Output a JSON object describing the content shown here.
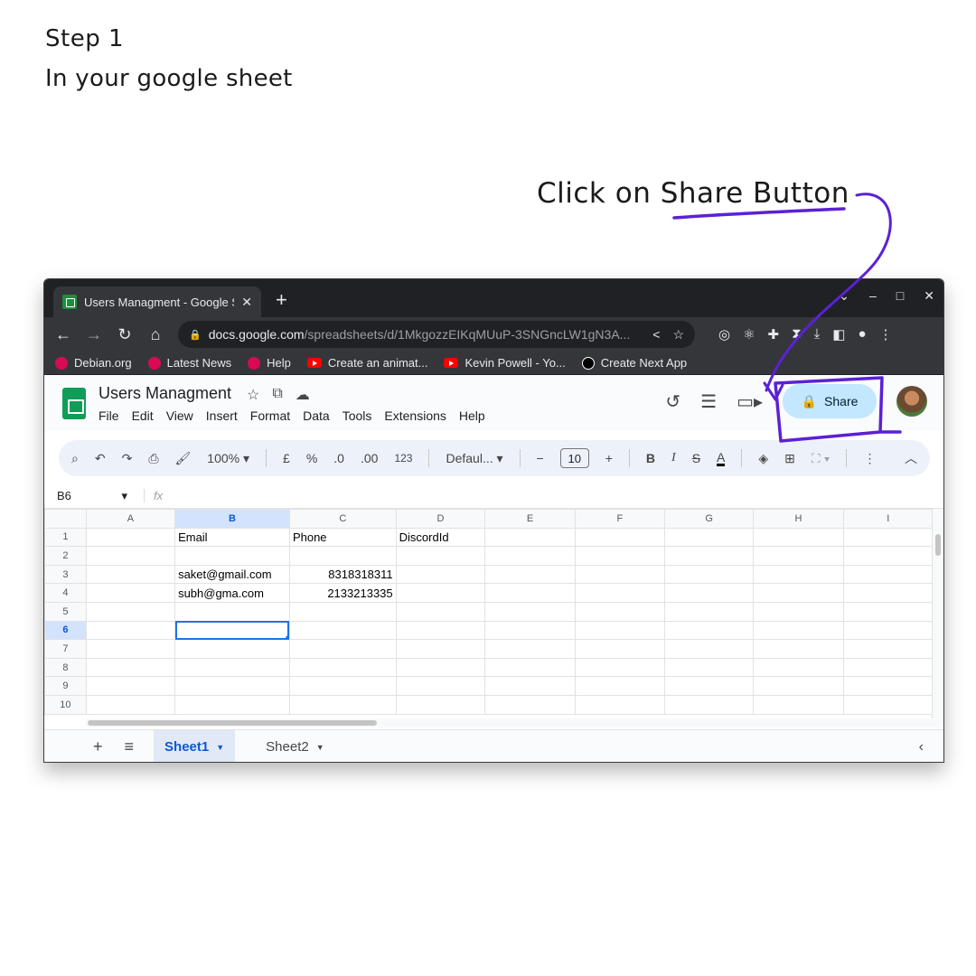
{
  "annotation": {
    "step_title": "Step 1",
    "step_subtitle": "In your google sheet",
    "callout": "Click on Share Button",
    "ink_color": "#5b21d6"
  },
  "browser": {
    "tab_title": "Users Managment - Google S",
    "tab_close": "✕",
    "new_tab": "+",
    "window_controls": [
      "⌄",
      "–",
      "□",
      "✕"
    ],
    "url_domain": "docs.google.com",
    "url_path": "/spreadsheets/d/1MkgozzEIKqMUuP-3SNGncLW1gN3A...",
    "bookmarks": [
      {
        "label": "Debian.org",
        "icon": "debian-icon",
        "color": "#d70a53"
      },
      {
        "label": "Latest News",
        "icon": "debian-icon",
        "color": "#d70a53"
      },
      {
        "label": "Help",
        "icon": "debian-icon",
        "color": "#d70a53"
      },
      {
        "label": "Create an animat...",
        "icon": "youtube-icon",
        "color": "#ff0000"
      },
      {
        "label": "Kevin Powell - Yo...",
        "icon": "youtube-icon",
        "color": "#ff0000"
      },
      {
        "label": "Create Next App",
        "icon": "nextjs-icon",
        "color": "#000000"
      }
    ]
  },
  "sheets": {
    "title": "Users Managment",
    "menu": [
      "File",
      "Edit",
      "View",
      "Insert",
      "Format",
      "Data",
      "Tools",
      "Extensions",
      "Help"
    ],
    "share_label": "Share",
    "accent_color": "#c2e7ff",
    "toolbar": {
      "zoom": "100%",
      "currency": "£",
      "percent": "%",
      "dec_decrease": ".0",
      "dec_increase": ".00",
      "number_format": "123",
      "font": "Defaul...",
      "font_size": "10"
    },
    "name_box": "B6",
    "fx": "fx",
    "columns": [
      "A",
      "B",
      "C",
      "D",
      "E",
      "F",
      "G",
      "H",
      "I"
    ],
    "rows": [
      {
        "n": "1",
        "A": "",
        "B": "Email",
        "C": "Phone",
        "D": "DiscordId"
      },
      {
        "n": "2",
        "A": "",
        "B": "",
        "C": "",
        "D": ""
      },
      {
        "n": "3",
        "A": "",
        "B": "saket@gmail.com",
        "C": "8318318311",
        "D": ""
      },
      {
        "n": "4",
        "A": "",
        "B": "subh@gma.com",
        "C": "2133213335",
        "D": ""
      },
      {
        "n": "5",
        "A": "",
        "B": "",
        "C": "",
        "D": ""
      },
      {
        "n": "6",
        "A": "",
        "B": "",
        "C": "",
        "D": ""
      },
      {
        "n": "7",
        "A": "",
        "B": "",
        "C": "",
        "D": ""
      },
      {
        "n": "8",
        "A": "",
        "B": "",
        "C": "",
        "D": ""
      },
      {
        "n": "9",
        "A": "",
        "B": "",
        "C": "",
        "D": ""
      },
      {
        "n": "10",
        "A": "",
        "B": "",
        "C": "",
        "D": ""
      }
    ],
    "sheet_tabs": [
      "Sheet1",
      "Sheet2"
    ]
  }
}
